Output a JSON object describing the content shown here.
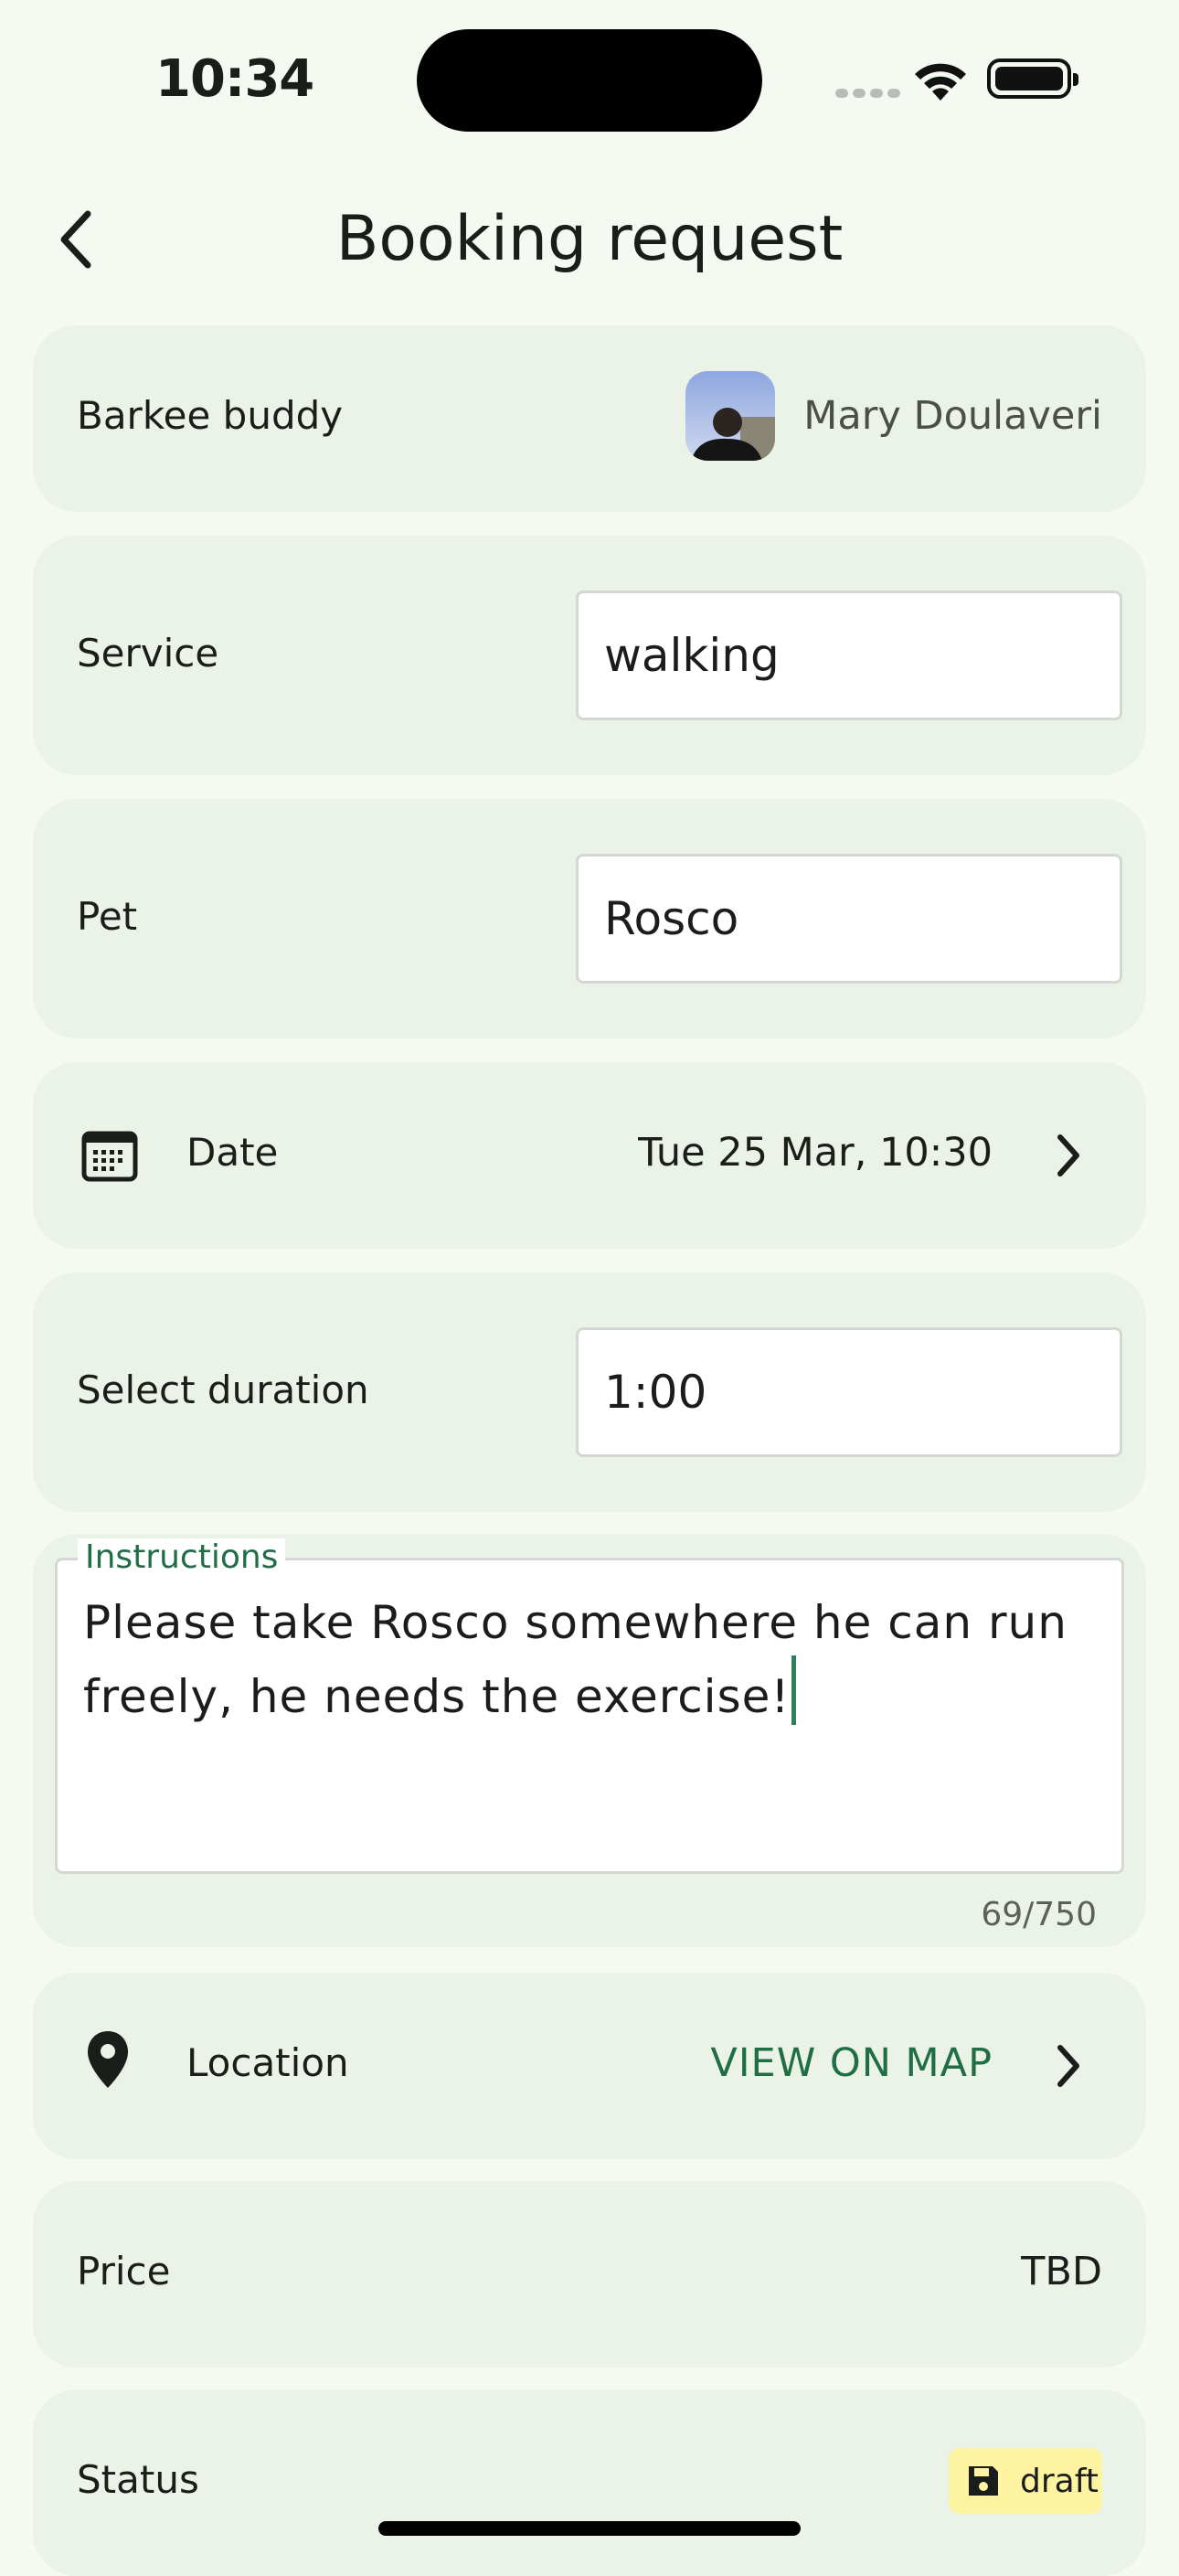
{
  "status_bar": {
    "time": "10:34"
  },
  "header": {
    "title": "Booking request"
  },
  "buddy": {
    "label": "Barkee buddy",
    "name": "Mary Doulaveri"
  },
  "service": {
    "label": "Service",
    "value": "walking"
  },
  "pet": {
    "label": "Pet",
    "value": "Rosco"
  },
  "date": {
    "label": "Date",
    "value": "Tue 25 Mar, 10:30"
  },
  "duration": {
    "label": "Select duration",
    "value": "1:00"
  },
  "instructions": {
    "label": "Instructions",
    "value": "Please take Rosco somewhere he can run freely, he needs the exercise!",
    "counter": "69/750"
  },
  "location": {
    "label": "Location",
    "link": "VIEW ON MAP"
  },
  "price": {
    "label": "Price",
    "value": "TBD"
  },
  "status": {
    "label": "Status",
    "badge": "draft"
  },
  "colors": {
    "accent": "#1f6e46",
    "card_bg": "#ebf3e8",
    "page_bg": "#f4faf2",
    "badge_bg": "#fdf3a1"
  },
  "icons": [
    "back-arrow-icon",
    "calendar-icon",
    "chevron-right-icon",
    "location-pin-icon",
    "save-icon",
    "wifi-icon",
    "battery-icon"
  ]
}
